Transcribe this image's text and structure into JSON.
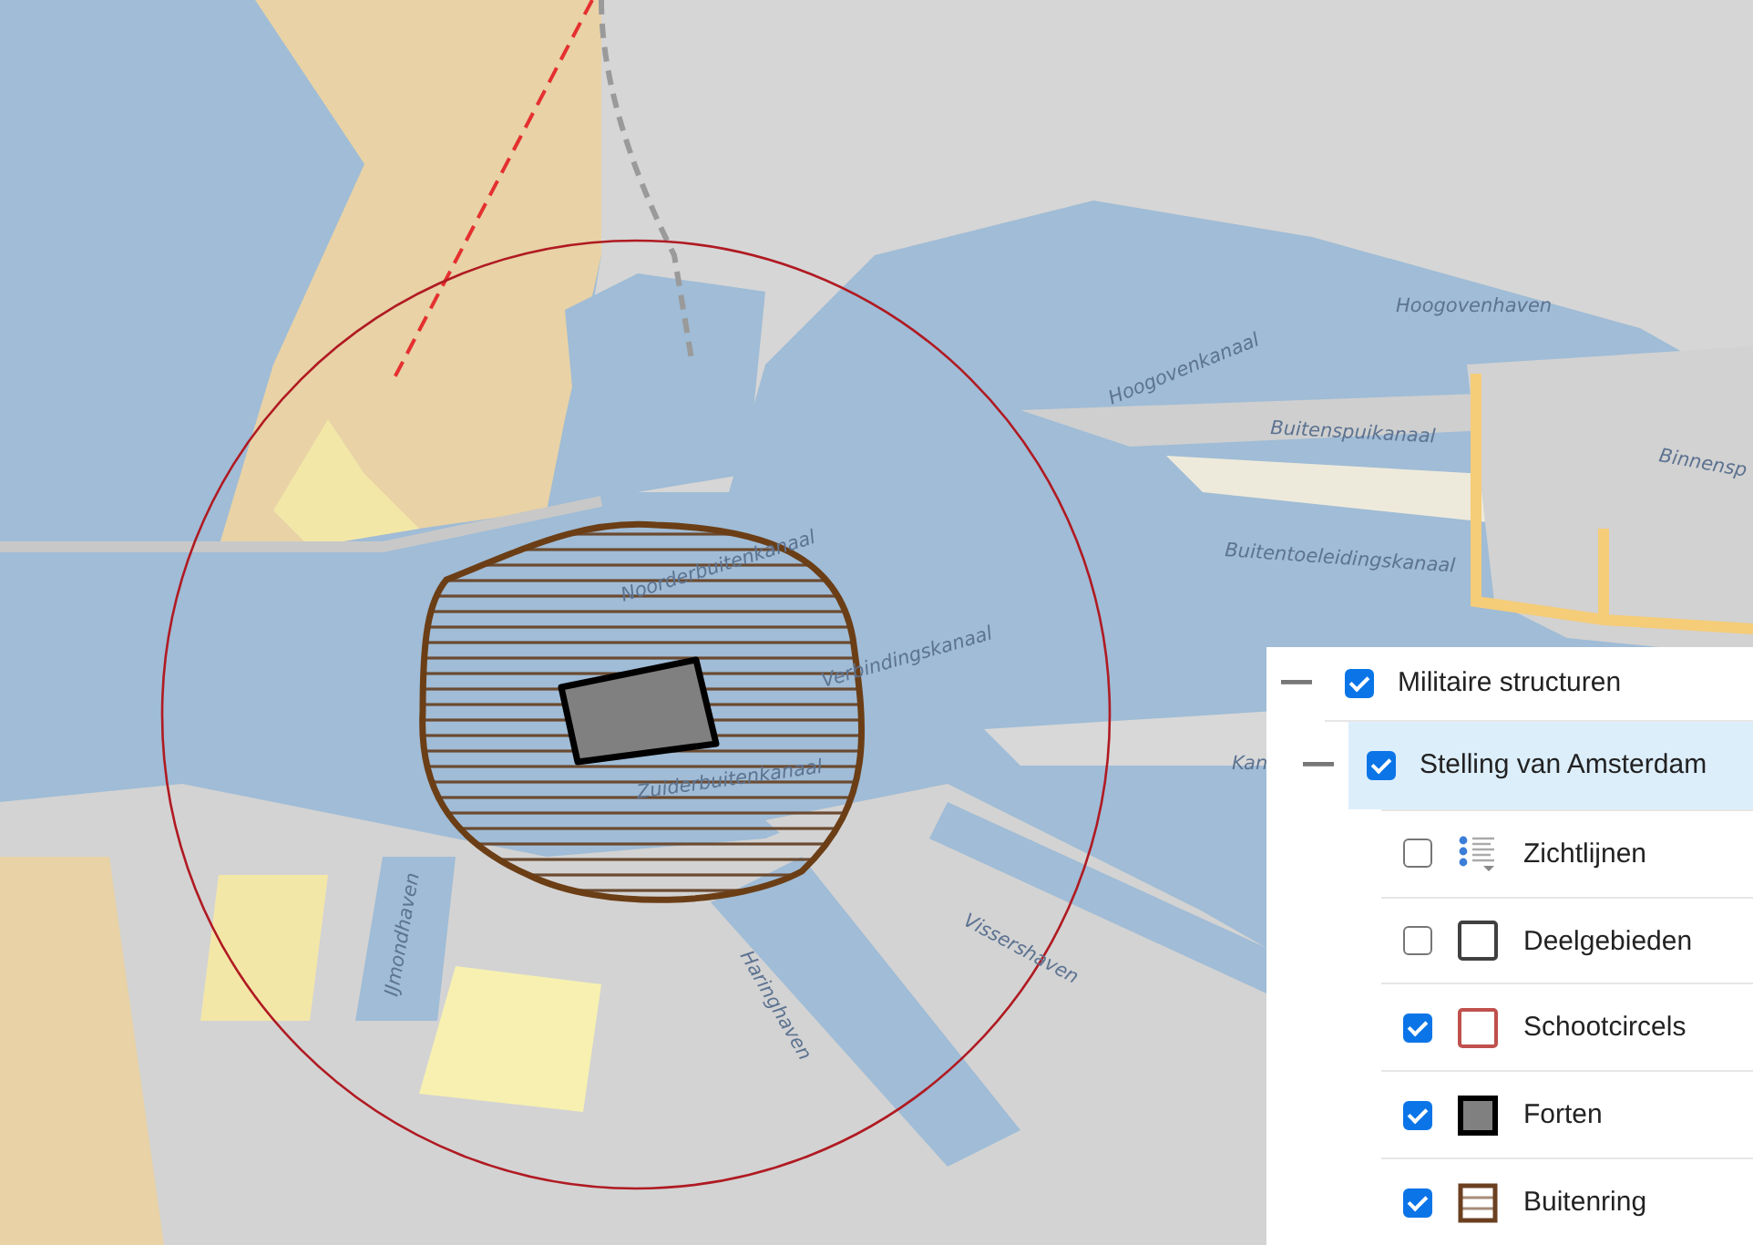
{
  "map": {
    "labels": [
      {
        "text": "Hoogovenhaven"
      },
      {
        "text": "Hoogovenkanaal"
      },
      {
        "text": "Buitenspuikanaal"
      },
      {
        "text": "Binnensp"
      },
      {
        "text": "Buitentoeleidingskanaal"
      },
      {
        "text": "Noorderbuitenkanaal"
      },
      {
        "text": "Verbindingskanaal"
      },
      {
        "text": "Zuiderbuitenkanaal"
      },
      {
        "text": "IJmondhaven"
      },
      {
        "text": "Haringhaven"
      },
      {
        "text": "Vissershaven"
      },
      {
        "text": "Kan"
      }
    ]
  },
  "layer_tree": {
    "items": [
      {
        "label": "Militaire structuren",
        "checked": true,
        "expanded": true,
        "selected": false,
        "children": [
          {
            "label": "Stelling van Amsterdam",
            "checked": true,
            "expanded": true,
            "selected": true,
            "children": [
              {
                "label": "Zichtlijnen",
                "checked": false,
                "kind": "list"
              },
              {
                "label": "Deelgebieden",
                "checked": false,
                "kind": "square",
                "color": "#404040"
              },
              {
                "label": "Schootcircels",
                "checked": true,
                "kind": "square",
                "color": "#c0504d"
              },
              {
                "label": "Forten",
                "checked": true,
                "kind": "filled",
                "color": "#808080"
              },
              {
                "label": "Buitenring",
                "checked": true,
                "kind": "hatched",
                "color": "#6b4020"
              }
            ]
          }
        ]
      }
    ]
  }
}
